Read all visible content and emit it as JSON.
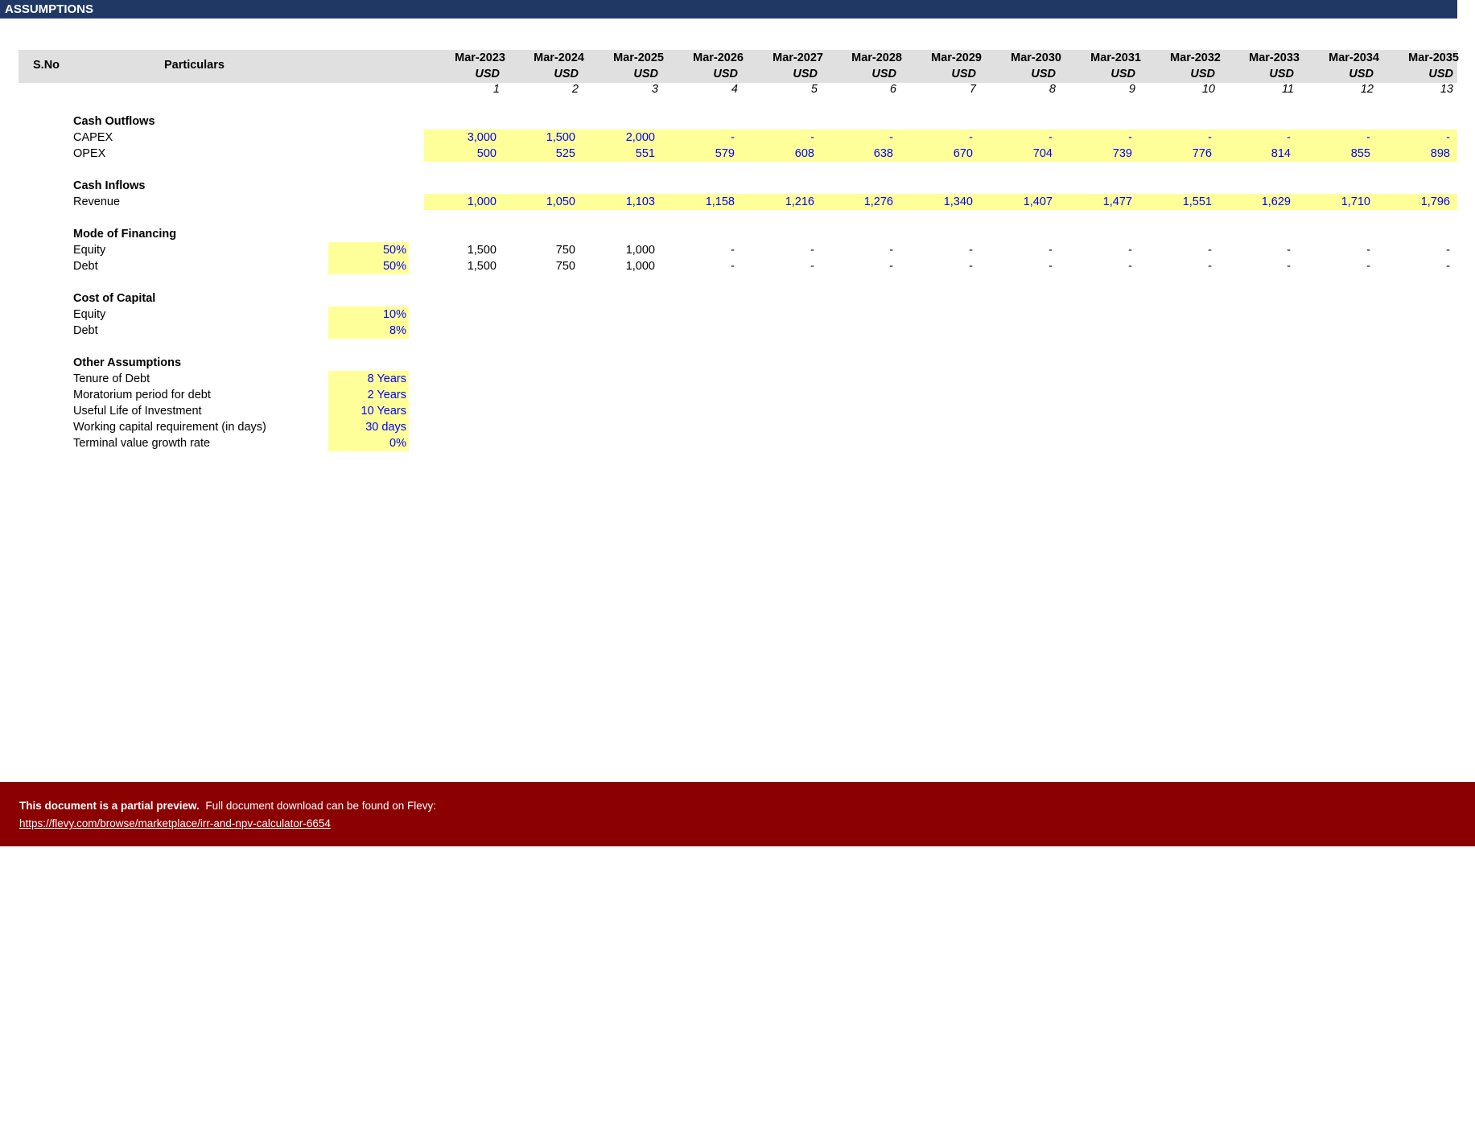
{
  "title": "ASSUMPTIONS",
  "header": {
    "sno": "S.No",
    "particulars": "Particulars",
    "periods": [
      "Mar-2023",
      "Mar-2024",
      "Mar-2025",
      "Mar-2026",
      "Mar-2027",
      "Mar-2028",
      "Mar-2029",
      "Mar-2030",
      "Mar-2031",
      "Mar-2032",
      "Mar-2033",
      "Mar-2034",
      "Mar-2035"
    ],
    "unit": "USD",
    "indices": [
      "1",
      "2",
      "3",
      "4",
      "5",
      "6",
      "7",
      "8",
      "9",
      "10",
      "11",
      "12",
      "13"
    ]
  },
  "sections": {
    "cash_outflows": {
      "title": "Cash Outflows",
      "rows": [
        {
          "label": "CAPEX",
          "values": [
            "3,000",
            "1,500",
            "2,000",
            "-",
            "-",
            "-",
            "-",
            "-",
            "-",
            "-",
            "-",
            "-",
            "-"
          ]
        },
        {
          "label": "OPEX",
          "values": [
            "500",
            "525",
            "551",
            "579",
            "608",
            "638",
            "670",
            "704",
            "739",
            "776",
            "814",
            "855",
            "898"
          ]
        }
      ]
    },
    "cash_inflows": {
      "title": "Cash Inflows",
      "rows": [
        {
          "label": "Revenue",
          "values": [
            "1,000",
            "1,050",
            "1,103",
            "1,158",
            "1,216",
            "1,276",
            "1,340",
            "1,407",
            "1,477",
            "1,551",
            "1,629",
            "1,710",
            "1,796"
          ]
        }
      ]
    },
    "mode_of_financing": {
      "title": "Mode of Financing",
      "rows": [
        {
          "label": "Equity",
          "input": "50%",
          "values": [
            "1,500",
            "750",
            "1,000",
            "-",
            "-",
            "-",
            "-",
            "-",
            "-",
            "-",
            "-",
            "-",
            "-"
          ]
        },
        {
          "label": "Debt",
          "input": "50%",
          "values": [
            "1,500",
            "750",
            "1,000",
            "-",
            "-",
            "-",
            "-",
            "-",
            "-",
            "-",
            "-",
            "-",
            "-"
          ]
        }
      ]
    },
    "cost_of_capital": {
      "title": "Cost of Capital",
      "rows": [
        {
          "label": "Equity",
          "input": "10%"
        },
        {
          "label": "Debt",
          "input": "8%"
        }
      ]
    },
    "other_assumptions": {
      "title": "Other Assumptions",
      "rows": [
        {
          "label": "Tenure of Debt",
          "input": "8 Years"
        },
        {
          "label": "Moratorium period for debt",
          "input": "2 Years"
        },
        {
          "label": "Useful Life of Investment",
          "input": "10 Years"
        },
        {
          "label": "Working capital requirement (in days)",
          "input": "30 days"
        },
        {
          "label": "Terminal value growth rate",
          "input": "0%"
        }
      ]
    }
  },
  "footer": {
    "bold": "This document is a partial preview.",
    "text": "Full document download can be found on Flevy:",
    "link": "https://flevy.com/browse/marketplace/irr-and-npv-calculator-6654"
  },
  "colors": {
    "title_bar": "#1f3864",
    "header_band": "#e0e0e0",
    "input_fill": "#ffff99",
    "input_text": "#0000ff",
    "footer": "#8b0000"
  }
}
